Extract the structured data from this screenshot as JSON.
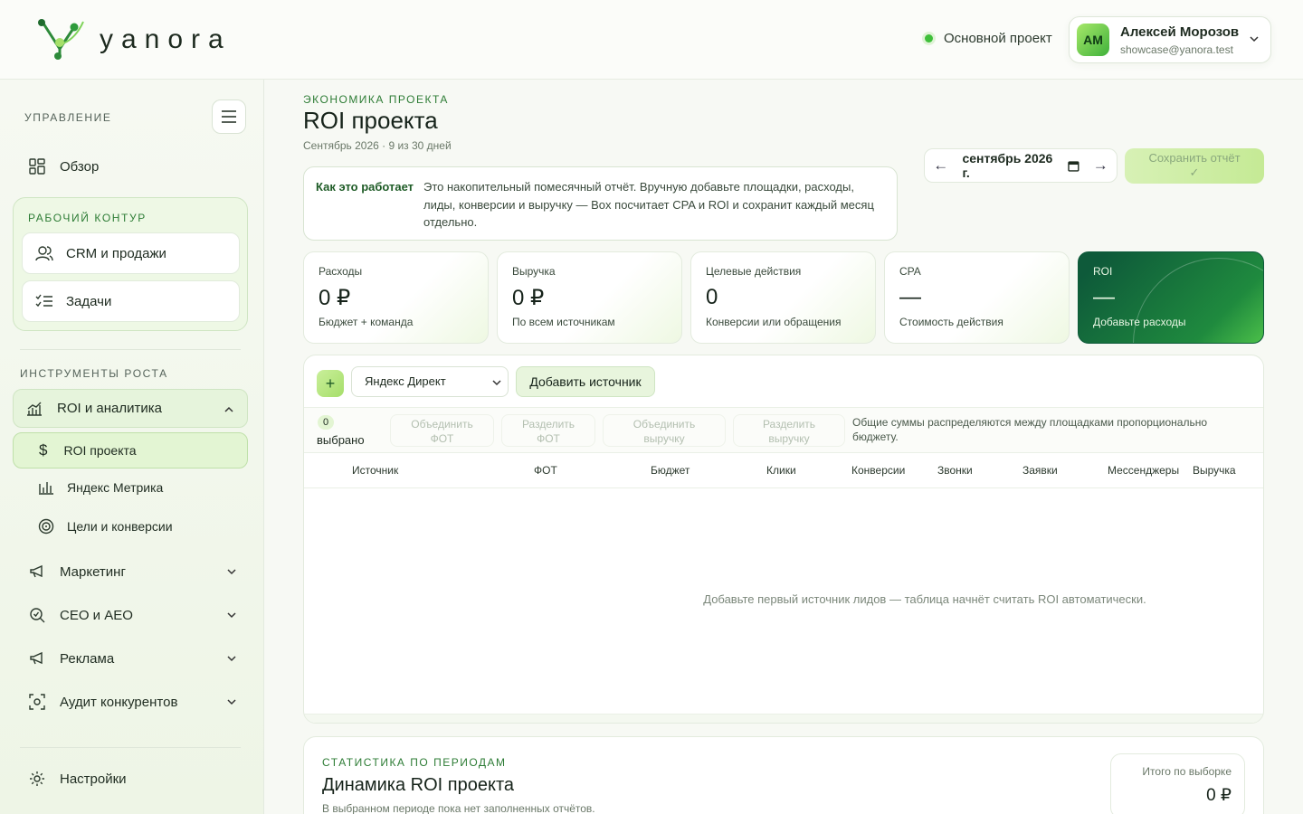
{
  "brand": {
    "name": "yanora"
  },
  "header": {
    "project": "Основной проект",
    "user": {
      "initials": "АМ",
      "name": "Алексей Морозов",
      "email": "showcase@yanora.test"
    }
  },
  "sidebar": {
    "section_manage": "УПРАВЛЕНИЕ",
    "overview": "Обзор",
    "workspace_label": "РАБОЧИЙ КОНТУР",
    "workspace_items": [
      "CRM и продажи",
      "Задачи"
    ],
    "growth_label": "ИНСТРУМЕНТЫ РОСТА",
    "roi_group": "ROI и аналитика",
    "roi_items": [
      "ROI проекта",
      "Яндекс Метрика",
      "Цели и конверсии"
    ],
    "groups": [
      "Маркетинг",
      "СЕО и АЕО",
      "Реклама",
      "Аудит конкурентов"
    ],
    "settings": "Настройки"
  },
  "page": {
    "eyebrow": "ЭКОНОМИКА ПРОЕКТА",
    "title": "ROI проекта",
    "subtitle": "Сентябрь 2026 · 9 из 30 дней",
    "info_label": "Как это работает",
    "info_text": "Это накопительный помесячный отчёт. Вручную добавьте площадки, расходы, лиды, конверсии и выручку — Box посчитает CPA и ROI и сохранит каждый месяц отдельно.",
    "date_value": "сентябрь 2026 г.",
    "save_label": "Сохранить отчёт",
    "save_icon": "✓"
  },
  "kpis": [
    {
      "label": "Расходы",
      "value": "0 ₽",
      "sub": "Бюджет + команда"
    },
    {
      "label": "Выручка",
      "value": "0 ₽",
      "sub": "По всем источникам"
    },
    {
      "label": "Целевые действия",
      "value": "0",
      "sub": "Конверсии или обращения"
    },
    {
      "label": "CPA",
      "value": "—",
      "sub": "Стоимость действия"
    },
    {
      "label": "ROI",
      "value": "—",
      "sub": "Добавьте расходы"
    }
  ],
  "table": {
    "add_symbol": "+",
    "source_select": "Яндекс Директ",
    "add_source": "Добавить источник",
    "selected_count": "0",
    "selected_label": "выбрано",
    "actions": [
      {
        "line1": "Объединить",
        "line2": "ФОТ"
      },
      {
        "line1": "Разделить",
        "line2": "ФОТ"
      },
      {
        "line1": "Объединить",
        "line2": "выручку"
      },
      {
        "line1": "Разделить",
        "line2": "выручку"
      }
    ],
    "note": "Общие суммы распределяются между площадками пропорционально бюджету.",
    "columns": [
      "Источник",
      "ФОТ",
      "Бюджет",
      "Клики",
      "Конверсии",
      "Звонки",
      "Заявки",
      "Мессенджеры",
      "Выручка"
    ],
    "empty": "Добавьте первый источник лидов — таблица начнёт считать ROI автоматически."
  },
  "stats": {
    "eyebrow": "СТАТИСТИКА ПО ПЕРИОДАМ",
    "title": "Динамика ROI проекта",
    "subtitle": "В выбранном периоде пока нет заполненных отчётов.",
    "total_label": "Итого по выборке",
    "total_value": "0 ₽"
  }
}
